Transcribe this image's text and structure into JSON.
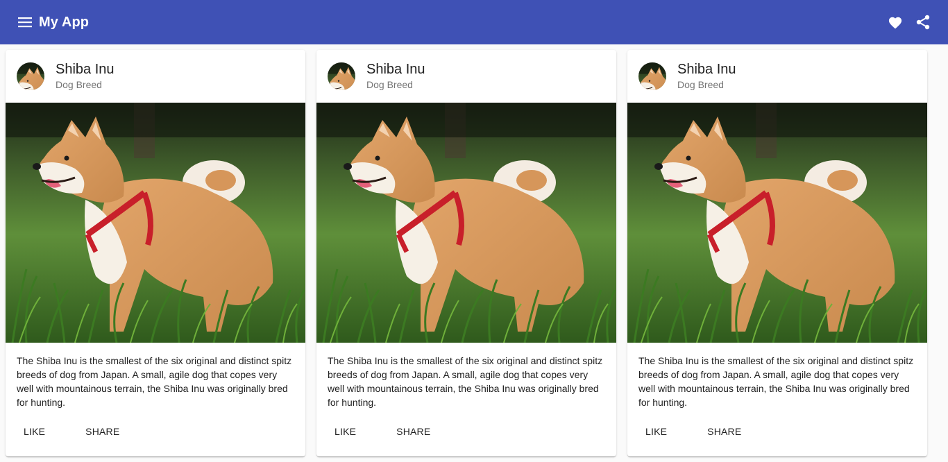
{
  "toolbar": {
    "title": "My App",
    "menu_icon": "menu-icon",
    "favorite_icon": "heart-icon",
    "share_icon": "share-icon",
    "color": "#3f51b5"
  },
  "cards": [
    {
      "title": "Shiba Inu",
      "subtitle": "Dog Breed",
      "image": "shiba-inu-photo",
      "content": "The Shiba Inu is the smallest of the six original and distinct spitz breeds of dog from Japan. A small, agile dog that copes very well with mountainous terrain, the Shiba Inu was originally bred for hunting.",
      "like_label": "LIKE",
      "share_label": "SHARE"
    },
    {
      "title": "Shiba Inu",
      "subtitle": "Dog Breed",
      "image": "shiba-inu-photo",
      "content": "The Shiba Inu is the smallest of the six original and distinct spitz breeds of dog from Japan. A small, agile dog that copes very well with mountainous terrain, the Shiba Inu was originally bred for hunting.",
      "like_label": "LIKE",
      "share_label": "SHARE"
    },
    {
      "title": "Shiba Inu",
      "subtitle": "Dog Breed",
      "image": "shiba-inu-photo",
      "content": "The Shiba Inu is the smallest of the six original and distinct spitz breeds of dog from Japan. A small, agile dog that copes very well with mountainous terrain, the Shiba Inu was originally bred for hunting.",
      "like_label": "LIKE",
      "share_label": "SHARE"
    }
  ]
}
